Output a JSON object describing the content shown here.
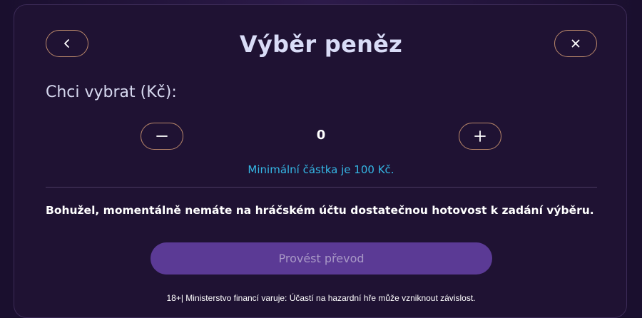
{
  "dialog": {
    "title": "Výběr peněz",
    "back_icon": "chevron-left-icon",
    "close_icon": "close-icon"
  },
  "amount": {
    "label": "Chci vybrat (Kč):",
    "value": "0",
    "decrement_icon": "minus-icon",
    "increment_icon": "plus-icon",
    "min_hint": "Minimální částka je 100 Kč."
  },
  "message": {
    "insufficient": "Bohužel, momentálně nemáte na hráčském účtu dostatečnou hotovost k zadání výběru."
  },
  "actions": {
    "submit_label": "Provést převod"
  },
  "footer": {
    "warning": "18+| Ministerstvo financí varuje: Účastí na hazardní hře může vzniknout závislost."
  },
  "colors": {
    "modal_background": "#1f1233",
    "button_border": "#b9876a",
    "hint": "#34b6e4",
    "submit_background": "#5b3a95",
    "submit_text": "#a898c6"
  }
}
